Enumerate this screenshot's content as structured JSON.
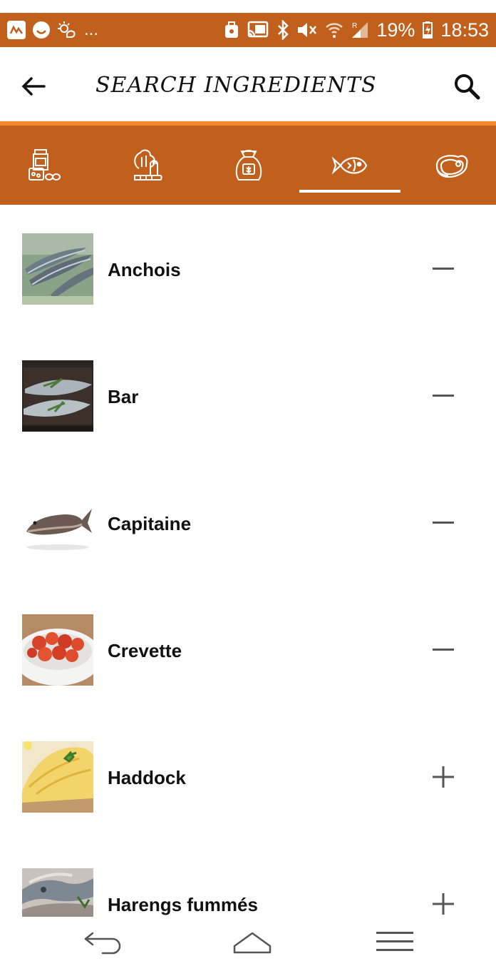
{
  "status_bar": {
    "overflow": "...",
    "battery": "19%",
    "time": "18:53"
  },
  "app_bar": {
    "title": "SEARCH INGREDIENTS"
  },
  "tabs": [
    {
      "icon": "pantry-jar-icon",
      "selected": false
    },
    {
      "icon": "vegetables-icon",
      "selected": false
    },
    {
      "icon": "grain-sack-icon",
      "selected": false
    },
    {
      "icon": "fish-icon",
      "selected": true
    },
    {
      "icon": "steak-icon",
      "selected": false
    }
  ],
  "items": [
    {
      "name": "Anchois",
      "action": "minus"
    },
    {
      "name": "Bar",
      "action": "minus"
    },
    {
      "name": "Capitaine",
      "action": "minus"
    },
    {
      "name": "Crevette",
      "action": "minus"
    },
    {
      "name": "Haddock",
      "action": "plus"
    },
    {
      "name": "Harengs fummés",
      "action": "plus"
    }
  ],
  "colors": {
    "primary": "#c0601c",
    "accent_line": "#f7862a",
    "icon_gray": "#555555"
  }
}
